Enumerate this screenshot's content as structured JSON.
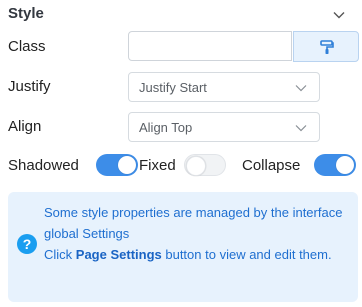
{
  "section": {
    "title": "Style"
  },
  "class_field": {
    "label": "Class",
    "value": "",
    "brush_icon": "paint-roller-icon"
  },
  "justify": {
    "label": "Justify",
    "selected": "Justify Start"
  },
  "align": {
    "label": "Align",
    "selected": "Align Top"
  },
  "toggles": [
    {
      "label": "Shadowed",
      "on": true
    },
    {
      "label": "Fixed",
      "on": false
    },
    {
      "label": "Collapse",
      "on": true
    }
  ],
  "info": {
    "icon": "question-icon",
    "line1": "Some style properties are managed by the interface global Settings",
    "line2_pre": "Click ",
    "line2_bold": "Page Settings",
    "line2_post": " button to view and edit them."
  },
  "colors": {
    "accent": "#3d8de8",
    "info_bg": "#e7f2fd",
    "info_text": "#1f6fd0"
  }
}
